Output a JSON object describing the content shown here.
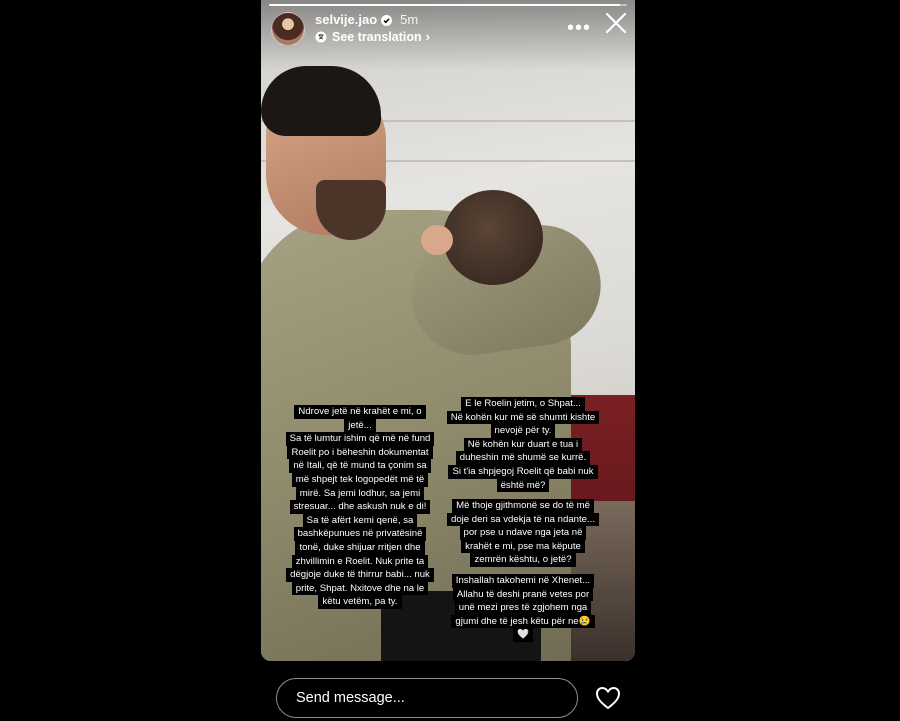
{
  "story": {
    "username": "selvije.jao",
    "time_ago": "5m",
    "translation_label": "See translation",
    "progress": 0.98,
    "icons": {
      "verified": "verified-badge-icon",
      "translate": "translate-icon",
      "more": "more-options-icon",
      "close": "close-icon"
    }
  },
  "captions": {
    "left": [
      "Ndrove jetë në krahët e mi, o",
      "jetë...",
      "Sa të lumtur ishim që më në fund",
      "Roelit po i bëheshin dokumentat",
      "në Itali, që të mund ta çonim sa",
      "më shpejt tek logopedët më të",
      "mirë. Sa jemi lodhur, sa jemi",
      "stresuar... dhe askush nuk e di!",
      "Sa të afërt kemi qenë, sa",
      "bashkëpunues në privatësinë",
      "tonë, duke shijuar rritjen dhe",
      "zhvillimin e Roelit. Nuk prite ta",
      "dëgjoje duke të thirrur babi... nuk",
      "prite, Shpat. Nxitove dhe na le",
      "këtu vetëm, pa ty."
    ],
    "right_1": [
      "E le Roelin jetim, o Shpat...",
      "Në kohën kur më së shumti kishte",
      "nevojë për ty.",
      "Në kohën kur duart e tua i",
      "duheshin më shumë se kurrë.",
      "Si t'ia shpjegoj Roelit që babi nuk",
      "është më?"
    ],
    "right_2": [
      "Më thoje gjithmonë se do të më",
      "doje deri sa vdekja të na ndante...",
      "por pse u ndave nga jeta në",
      "krahët e mi, pse ma këpute",
      "zemrën kështu, o jetë?"
    ],
    "right_3": [
      "Inshallah takohemi në Xhenet...",
      "Allahu të deshi pranë vetes por",
      "unë mezi pres të zgjohem nga",
      "gjumi dhe të jesh këtu për ne😢",
      "🤍"
    ]
  },
  "footer": {
    "message_placeholder": "Send message...",
    "like_icon": "heart-icon"
  },
  "colors": {
    "background": "#000000",
    "caption_bg": "#000000",
    "caption_text": "#ffffff",
    "input_border": "#8e8e8e"
  }
}
